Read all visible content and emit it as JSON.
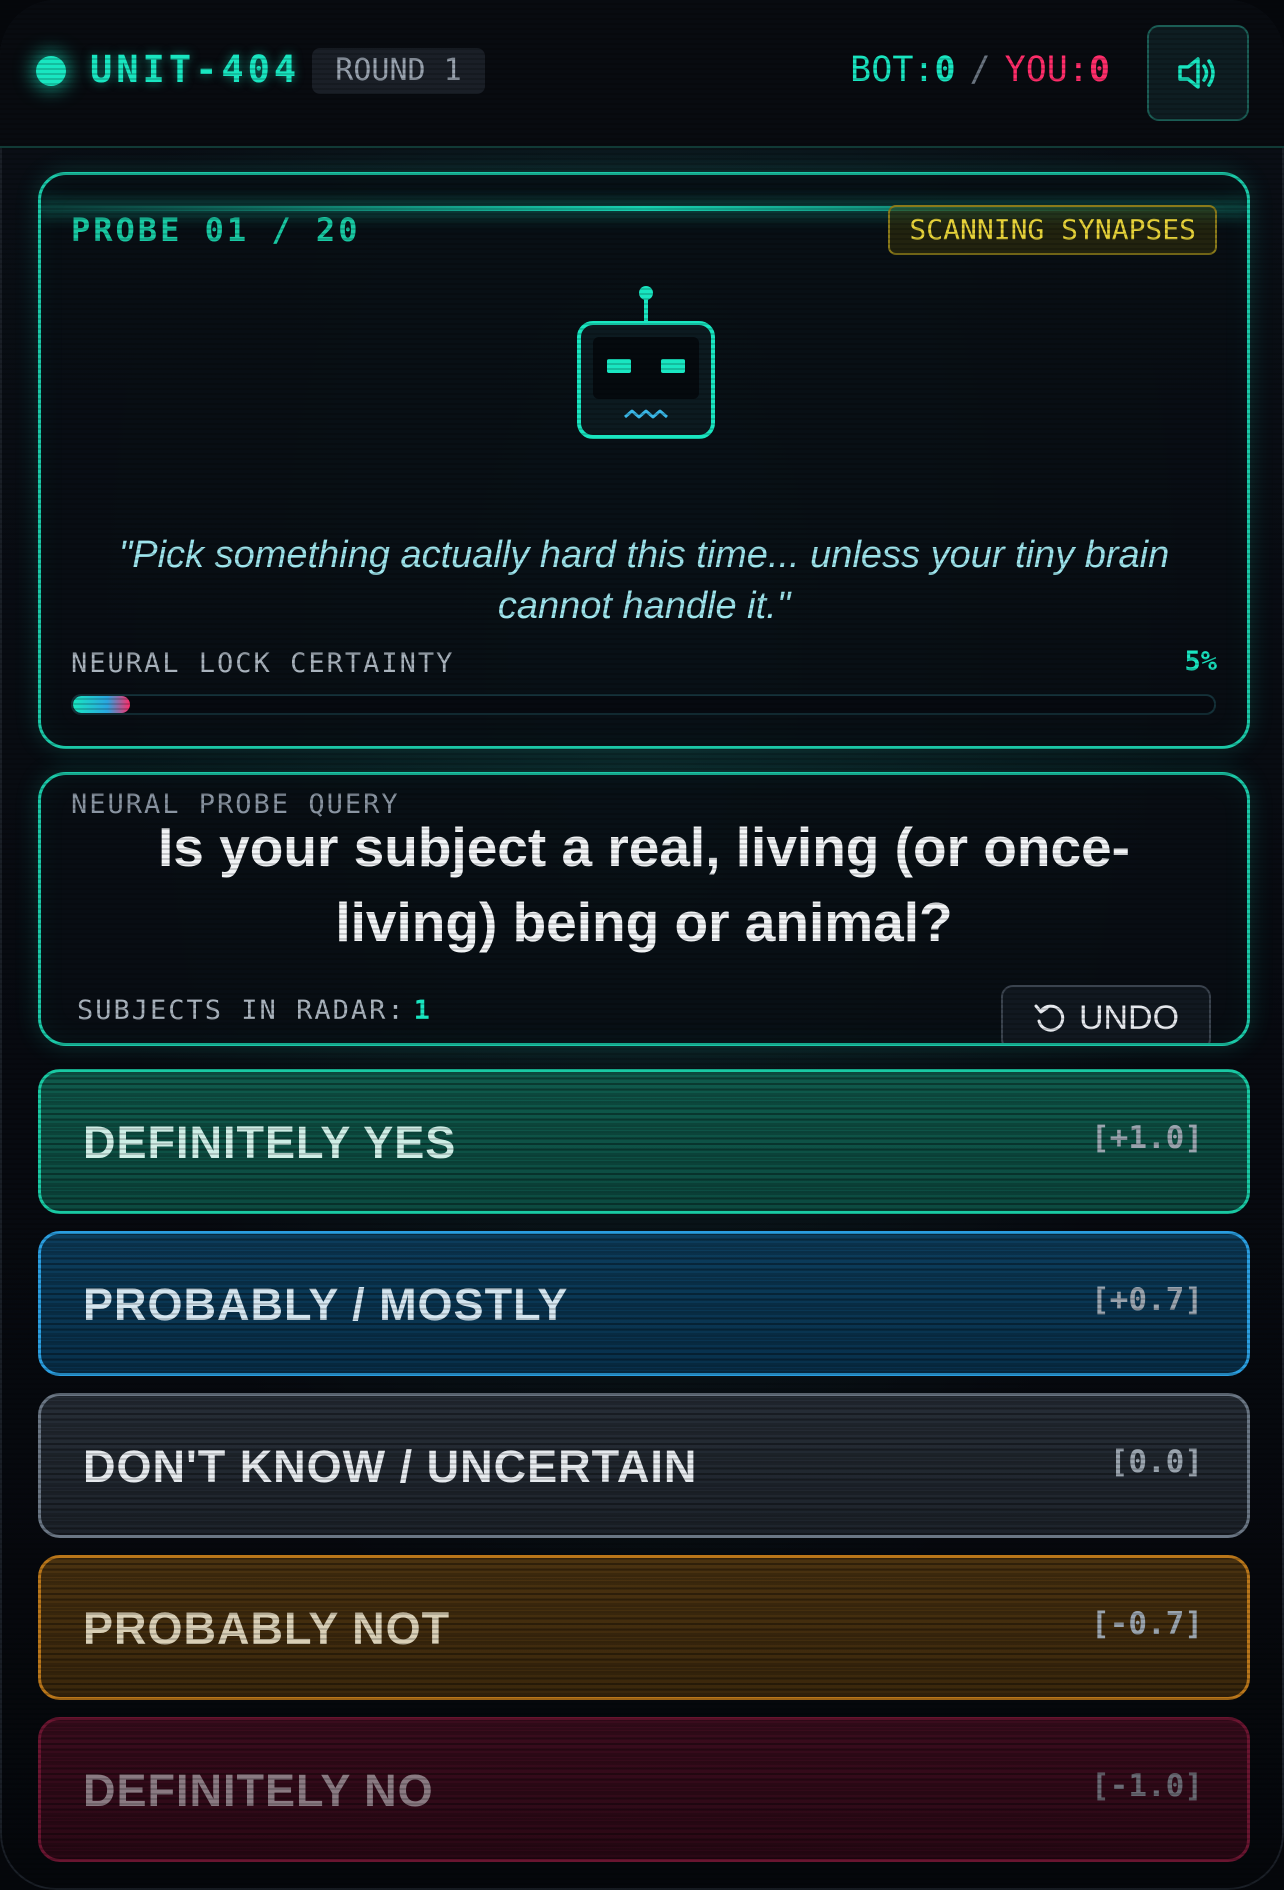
{
  "header": {
    "unit_name": "UNIT-404",
    "round_label": "ROUND 1",
    "score": {
      "bot_label": "BOT:",
      "bot_value": "0",
      "separator": "/",
      "you_label": "YOU:",
      "you_value": "0"
    },
    "sound_icon": "speaker-volume-icon"
  },
  "robot": {
    "probe_label": "PROBE 01 / 20",
    "status_badge": "SCANNING SYNAPSES",
    "face_icon": "robot-face-icon",
    "quote": "\"Pick something actually hard this time... unless your tiny brain cannot handle it.\"",
    "certainty_label": "NEURAL LOCK CERTAINTY",
    "certainty_value": "5%",
    "certainty_fraction": 0.05
  },
  "query": {
    "label": "NEURAL PROBE QUERY",
    "question": "Is your subject a real, living (or once-living) being or animal?",
    "subjects_label": "SUBJECTS IN RADAR:",
    "subjects_count": "1",
    "undo_label": "UNDO",
    "undo_icon": "undo-icon"
  },
  "answers": [
    {
      "label": "DEFINITELY YES",
      "weight": "[+1.0]"
    },
    {
      "label": "PROBABLY / MOSTLY",
      "weight": "[+0.7]"
    },
    {
      "label": "DON'T KNOW / UNCERTAIN",
      "weight": "[0.0]"
    },
    {
      "label": "PROBABLY NOT",
      "weight": "[-0.7]"
    },
    {
      "label": "DEFINITELY NO",
      "weight": "[-1.0]"
    }
  ],
  "colors": {
    "accent": "#19e6c1",
    "you_color": "#ff2d6a",
    "badge_yellow": "#e8d43a",
    "yes": "#19c9a3",
    "probably": "#2a9ee0",
    "unknown": "#6a7684",
    "probably_not": "#b9761a",
    "no": "#6a1530"
  }
}
